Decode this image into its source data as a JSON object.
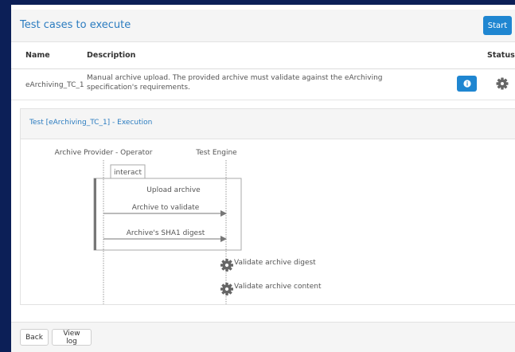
{
  "panel": {
    "title": "Test cases to execute",
    "start_label": "Start"
  },
  "table": {
    "headers": {
      "name": "Name",
      "description": "Description",
      "status": "Status"
    },
    "rows": [
      {
        "name": "eArchiving_TC_1",
        "description": "Manual archive upload. The provided archive must validate against the eArchiving specification's requirements.",
        "info_icon": "info-icon",
        "status_icon": "gear-icon"
      }
    ]
  },
  "execution": {
    "title": "Test [eArchiving_TC_1] - Execution",
    "actors": [
      "Archive Provider - Operator",
      "Test Engine"
    ],
    "frame_label": "interact",
    "frame_title": "Upload archive",
    "messages": [
      "Archive to validate",
      "Archive's SHA1 digest"
    ],
    "steps": [
      "Validate archive digest",
      "Validate archive content"
    ]
  },
  "footer": {
    "back_label": "Back",
    "view_log_label": "View log"
  },
  "colors": {
    "background": "#0c1f57",
    "accent": "#1f86d1",
    "link": "#2b7cc0"
  }
}
